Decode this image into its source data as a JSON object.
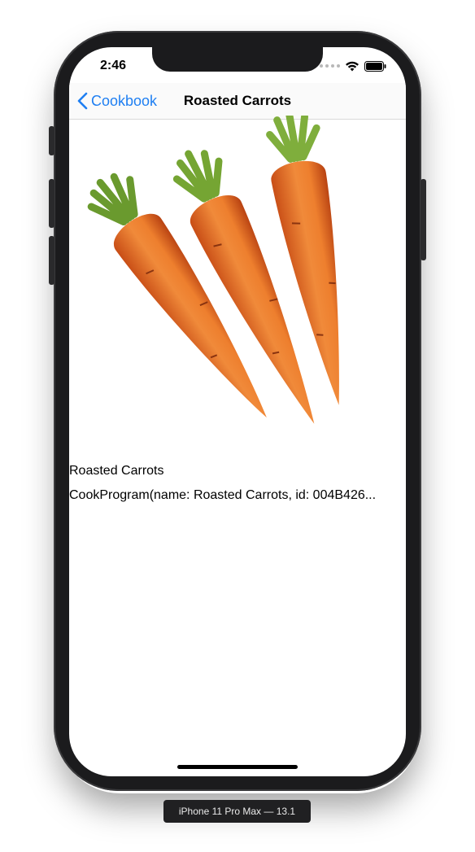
{
  "status_bar": {
    "time": "2:46"
  },
  "nav": {
    "back_label": "Cookbook",
    "title": "Roasted Carrots"
  },
  "content": {
    "recipe_name": "Roasted Carrots",
    "recipe_detail": "CookProgram(name: Roasted Carrots, id: 004B426..."
  },
  "simulator": {
    "device_label": "iPhone 11 Pro Max — 13.1"
  },
  "colors": {
    "accent": "#1f7ff2",
    "carrot": "#e8732a",
    "leaf": "#7fae3c"
  },
  "icons": [
    "chevron-left-icon",
    "wifi-icon",
    "battery-icon",
    "carrot-image"
  ]
}
